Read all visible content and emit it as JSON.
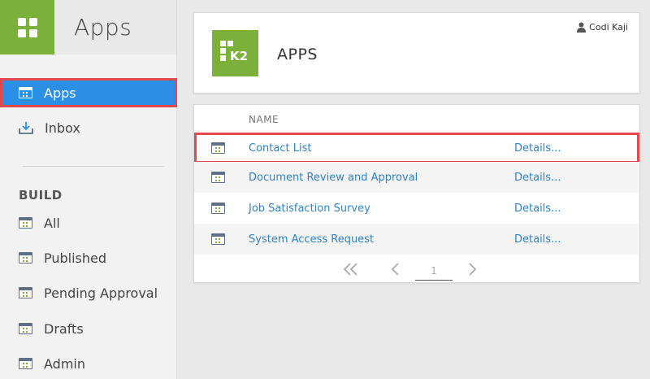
{
  "sidebar": {
    "title": "Apps",
    "nav": [
      {
        "label": "Apps",
        "icon": "apps-icon",
        "active": true
      },
      {
        "label": "Inbox",
        "icon": "inbox-icon",
        "active": false
      }
    ],
    "section_label": "BUILD",
    "build_items": [
      {
        "label": "All",
        "icon": "app-icon"
      },
      {
        "label": "Published",
        "icon": "app-icon"
      },
      {
        "label": "Pending Approval",
        "icon": "app-icon"
      },
      {
        "label": "Drafts",
        "icon": "app-icon"
      },
      {
        "label": "Admin",
        "icon": "app-icon"
      }
    ]
  },
  "header": {
    "logo_text": "K2",
    "page_heading": "APPS",
    "user_name": "Codi Kaji"
  },
  "table": {
    "column_name": "NAME",
    "rows": [
      {
        "name": "Contact List",
        "details": "Details...",
        "selected": true
      },
      {
        "name": "Document Review and Approval",
        "details": "Details...",
        "selected": false
      },
      {
        "name": "Job Satisfaction Survey",
        "details": "Details...",
        "selected": false
      },
      {
        "name": "System Access Request",
        "details": "Details...",
        "selected": false
      }
    ]
  },
  "pager": {
    "page": "1",
    "first_icon": "double-chevron-left-icon",
    "prev_icon": "chevron-left-icon",
    "next_icon": "chevron-right-icon"
  },
  "colors": {
    "accent_green": "#7bb03a",
    "active_blue": "#2c8fe6",
    "highlight_red": "#e5484d",
    "link_blue": "#2f82c8"
  }
}
